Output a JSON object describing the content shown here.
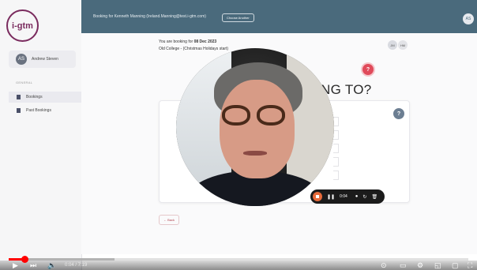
{
  "brand": {
    "logo_text": "i-gtm",
    "color": "#7a2b5e"
  },
  "sidebar": {
    "user": {
      "initials": "AS",
      "name": "Andrew Steven"
    },
    "section_label": "GENERAL",
    "items": [
      {
        "label": "Bookings",
        "icon": "document-icon",
        "active": true
      },
      {
        "label": "Past Bookings",
        "icon": "document-icon",
        "active": false
      }
    ]
  },
  "topbar": {
    "booking_text": "Booking for Kenneth Manning (Ireland.Manning@test.i-gtm.com)",
    "choose_label": "Choose Another",
    "avatar_initials": "AS",
    "color": "#4a6a7c"
  },
  "main": {
    "booking_date_prefix": "You are booking for",
    "booking_date": "08 Dec 2023",
    "booking_event": "Old College - (Christmas Holidays start)",
    "attendees": [
      "JM",
      "HM"
    ],
    "question_heading": "ING TO?",
    "back_label": "← Back"
  },
  "recorder": {
    "time": "0:04",
    "stop_color": "#e86a3a"
  },
  "video_player": {
    "time_display": "0:04 / 7:19",
    "played_fraction": 0.035,
    "buffered_fraction": 0.23,
    "progress_color": "#ff0000"
  }
}
